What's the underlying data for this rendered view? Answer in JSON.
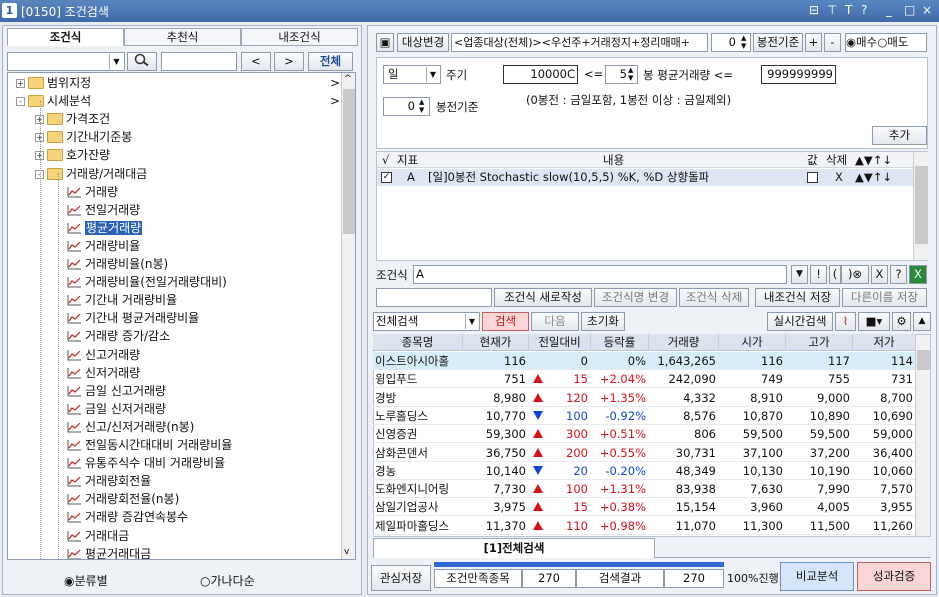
{
  "window": {
    "num": "1",
    "title": "[0150] 조건검색",
    "controls": [
      "⊟",
      "⊤",
      "T",
      "?",
      "_",
      "□",
      "×"
    ]
  },
  "left": {
    "tabs": [
      "조건식",
      "추천식",
      "내조건식"
    ],
    "search_btns": {
      "prev": "<",
      "next": ">",
      "all": "전체"
    },
    "tree": [
      {
        "label": "범위지정",
        "level": 0,
        "type": "folder",
        "exp": "+",
        "arrow": ">"
      },
      {
        "label": "시세분석",
        "level": 0,
        "type": "folder",
        "exp": "-",
        "arrow": ">"
      },
      {
        "label": "가격조건",
        "level": 1,
        "type": "folder",
        "exp": "+"
      },
      {
        "label": "기간내기준봉",
        "level": 1,
        "type": "folder",
        "exp": "+"
      },
      {
        "label": "호가잔량",
        "level": 1,
        "type": "folder",
        "exp": "+"
      },
      {
        "label": "거래량/거래대금",
        "level": 1,
        "type": "folder",
        "exp": "-"
      },
      {
        "label": "거래량",
        "level": 2,
        "type": "item"
      },
      {
        "label": "전일거래량",
        "level": 2,
        "type": "item"
      },
      {
        "label": "평균거래량",
        "level": 2,
        "type": "item",
        "selected": true
      },
      {
        "label": "거래량비율",
        "level": 2,
        "type": "item"
      },
      {
        "label": "거래량비율(n봉)",
        "level": 2,
        "type": "item"
      },
      {
        "label": "거래량비율(전일거래량대비)",
        "level": 2,
        "type": "item"
      },
      {
        "label": "기간내 거래량비율",
        "level": 2,
        "type": "item"
      },
      {
        "label": "기간내 평균거래량비율",
        "level": 2,
        "type": "item"
      },
      {
        "label": "거래량 증가/감소",
        "level": 2,
        "type": "item"
      },
      {
        "label": "신고거래량",
        "level": 2,
        "type": "item"
      },
      {
        "label": "신저거래량",
        "level": 2,
        "type": "item"
      },
      {
        "label": "금일 신고거래량",
        "level": 2,
        "type": "item"
      },
      {
        "label": "금일 신저거래량",
        "level": 2,
        "type": "item"
      },
      {
        "label": "신고/신저거래량(n봉)",
        "level": 2,
        "type": "item"
      },
      {
        "label": "전일동시간대대비 거래량비율",
        "level": 2,
        "type": "item"
      },
      {
        "label": "유통주식수 대비 거래량비율",
        "level": 2,
        "type": "item"
      },
      {
        "label": "거래량회전율",
        "level": 2,
        "type": "item"
      },
      {
        "label": "거래량회전율(n봉)",
        "level": 2,
        "type": "item"
      },
      {
        "label": "거래량 증감연속봉수",
        "level": 2,
        "type": "item"
      },
      {
        "label": "거래대금",
        "level": 2,
        "type": "item"
      },
      {
        "label": "평균거래대금",
        "level": 2,
        "type": "item"
      }
    ],
    "radio": {
      "opt1": "분류별",
      "opt2": "가나다순"
    }
  },
  "right": {
    "target_btn": "대상변경",
    "target_text": "<업종대상(전체)><우선주+거래정지+정리매매+",
    "bong_val": "0",
    "bong_label": "봉전기준",
    "plus": "+",
    "minus": "-",
    "buy": "매수",
    "sell": "매도",
    "period": {
      "value": "일",
      "label": "주기",
      "bong": "0",
      "bong_label": "봉전기준"
    },
    "cond": {
      "v1": "10000C",
      "op1": "<=",
      "v2": "5",
      "mid": "봉 평균거래량 <=",
      "v3": "999999999"
    },
    "note": "(0봉전 : 금일포함, 1봉전 이상 : 금일제외)",
    "add_btn": "추가",
    "ind_headers": [
      "√",
      "지표",
      "내용",
      "값",
      "삭제",
      "▲▼↑↓"
    ],
    "ind_row": {
      "id": "A",
      "content": "[일]0봉전 Stochastic slow(10,5,5) %K, %D 상향돌파",
      "del": "X",
      "arrows": "▲▼↑↓"
    },
    "formula_label": "조건식",
    "formula_value": "A",
    "fbtns": [
      "▼",
      "!",
      "(",
      ")⊗",
      "X",
      "?"
    ],
    "actions": [
      "조건식 새로작성",
      "조건식명 변경",
      "조건식 삭제",
      "내조건식 저장",
      "다른이름 저장"
    ],
    "search_scope": "전체검색",
    "search_btn": "검색",
    "next_btn": "다음",
    "reset_btn": "초기화",
    "realtime_btn": "실시간검색"
  },
  "table": {
    "headers": [
      "종목명",
      "현재가",
      "전일대비",
      "등락률",
      "거래량",
      "시가",
      "고가",
      "저가"
    ],
    "rows": [
      {
        "name": "이스트아시아홀",
        "price": "116",
        "dir": "none",
        "chg": "0",
        "rate": "0%",
        "vol": "1,643,265",
        "open": "116",
        "high": "117",
        "low": "114",
        "hl": true
      },
      {
        "name": "윙입푸드",
        "price": "751",
        "dir": "up",
        "chg": "15",
        "rate": "+2.04%",
        "vol": "242,090",
        "open": "749",
        "high": "755",
        "low": "731"
      },
      {
        "name": "경방",
        "price": "8,980",
        "dir": "up",
        "chg": "120",
        "rate": "+1.35%",
        "vol": "4,332",
        "open": "8,910",
        "high": "9,000",
        "low": "8,700"
      },
      {
        "name": "노루홀딩스",
        "price": "10,770",
        "dir": "dn",
        "chg": "100",
        "rate": "-0.92%",
        "vol": "8,576",
        "open": "10,870",
        "high": "10,890",
        "low": "10,690"
      },
      {
        "name": "신영증권",
        "price": "59,300",
        "dir": "up",
        "chg": "300",
        "rate": "+0.51%",
        "vol": "806",
        "open": "59,500",
        "high": "59,500",
        "low": "59,000"
      },
      {
        "name": "삼화콘덴서",
        "price": "36,750",
        "dir": "up",
        "chg": "200",
        "rate": "+0.55%",
        "vol": "30,731",
        "open": "37,100",
        "high": "37,200",
        "low": "36,400"
      },
      {
        "name": "경농",
        "price": "10,140",
        "dir": "dn",
        "chg": "20",
        "rate": "-0.20%",
        "vol": "48,349",
        "open": "10,130",
        "high": "10,190",
        "low": "10,060"
      },
      {
        "name": "도화엔지니어링",
        "price": "7,730",
        "dir": "up",
        "chg": "100",
        "rate": "+1.31%",
        "vol": "83,938",
        "open": "7,630",
        "high": "7,990",
        "low": "7,570"
      },
      {
        "name": "삼일기업공사",
        "price": "3,975",
        "dir": "up",
        "chg": "15",
        "rate": "+0.38%",
        "vol": "15,154",
        "open": "3,960",
        "high": "4,005",
        "low": "3,955"
      },
      {
        "name": "제일파마홀딩스",
        "price": "11,370",
        "dir": "up",
        "chg": "110",
        "rate": "+0.98%",
        "vol": "11,070",
        "open": "11,300",
        "high": "11,500",
        "low": "11,260"
      }
    ]
  },
  "bottom": {
    "tab": "[1]전체검색",
    "save": "관심저장",
    "cond_label": "조건만족종목",
    "cond_val": "270",
    "res_label": "검색결과",
    "res_val": "270",
    "progress": "100%진행",
    "compare": "비교분석",
    "verify": "성과검증"
  }
}
